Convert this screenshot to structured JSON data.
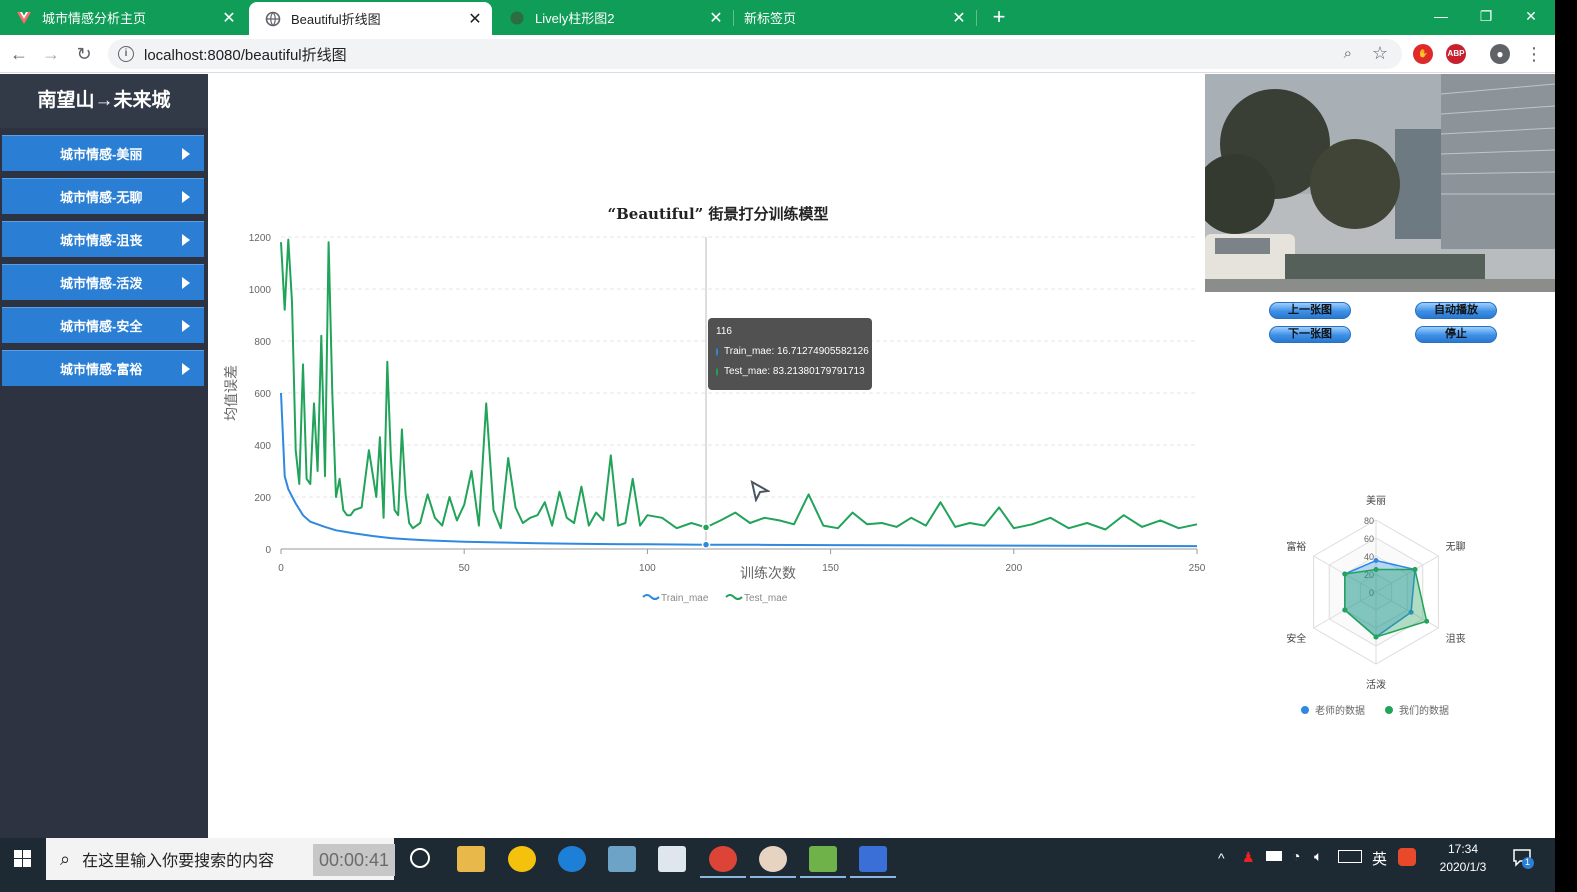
{
  "browser": {
    "tabs": [
      {
        "title": "城市情感分析主页",
        "active": false
      },
      {
        "title": "Beautiful折线图",
        "active": true
      },
      {
        "title": "Lively柱形图2",
        "active": false
      },
      {
        "title": "新标签页",
        "active": false
      }
    ],
    "url": "localhost:8080/beautiful折线图"
  },
  "sidebar": {
    "brand": "南望山→未来城",
    "items": [
      {
        "label": "城市情感-美丽"
      },
      {
        "label": "城市情感-无聊"
      },
      {
        "label": "城市情感-沮丧"
      },
      {
        "label": "城市情感-活泼"
      },
      {
        "label": "城市情感-安全"
      },
      {
        "label": "城市情感-富裕"
      }
    ]
  },
  "tooltip": {
    "title": "116",
    "rows": [
      {
        "name": "Train_mae",
        "value": "16.71274905582126",
        "color": "#2f89e0"
      },
      {
        "name": "Test_mae",
        "value": "83.21380179791713",
        "color": "#22a35a"
      }
    ]
  },
  "chart_data": [
    {
      "type": "line",
      "title": "“Beautiful” 街景打分训练模型",
      "xlabel": "训练次数",
      "ylabel": "均值误差",
      "xlim": [
        0,
        250
      ],
      "ylim": [
        0,
        1200
      ],
      "xticks": [
        0,
        50,
        100,
        150,
        200,
        250
      ],
      "yticks": [
        0,
        200,
        400,
        600,
        800,
        1000,
        1200
      ],
      "grid": true,
      "legend_position": "bottom",
      "highlight_x": 116,
      "series": [
        {
          "name": "Train_mae",
          "color": "#2f89e0",
          "x": [
            0,
            1,
            2,
            4,
            6,
            8,
            10,
            12,
            15,
            18,
            20,
            25,
            30,
            35,
            40,
            50,
            60,
            70,
            80,
            90,
            100,
            116,
            130,
            150,
            175,
            200,
            225,
            250
          ],
          "y": [
            600,
            280,
            230,
            175,
            130,
            105,
            95,
            85,
            72,
            65,
            60,
            50,
            42,
            37,
            33,
            28,
            25,
            22,
            20,
            19,
            18,
            16.7,
            16,
            15,
            14,
            13,
            12,
            11
          ]
        },
        {
          "name": "Test_mae",
          "color": "#22a35a",
          "x": [
            0,
            1,
            2,
            3,
            4,
            5,
            6,
            7,
            8,
            9,
            10,
            11,
            12,
            13,
            14,
            15,
            16,
            17,
            18,
            19,
            20,
            22,
            24,
            26,
            27,
            28,
            29,
            30,
            31,
            32,
            33,
            34,
            35,
            36,
            38,
            40,
            42,
            44,
            46,
            48,
            50,
            52,
            54,
            56,
            58,
            60,
            62,
            64,
            66,
            68,
            70,
            72,
            74,
            76,
            78,
            80,
            82,
            84,
            86,
            88,
            90,
            92,
            94,
            96,
            98,
            100,
            104,
            108,
            112,
            116,
            120,
            124,
            128,
            132,
            136,
            140,
            144,
            148,
            152,
            156,
            160,
            164,
            168,
            172,
            176,
            180,
            184,
            188,
            192,
            196,
            200,
            205,
            210,
            215,
            220,
            225,
            230,
            235,
            240,
            245,
            250
          ],
          "y": [
            1180,
            920,
            1190,
            950,
            380,
            250,
            710,
            270,
            250,
            560,
            300,
            820,
            280,
            1180,
            600,
            200,
            270,
            150,
            130,
            130,
            150,
            160,
            380,
            200,
            430,
            120,
            720,
            350,
            150,
            130,
            460,
            210,
            100,
            80,
            100,
            210,
            120,
            90,
            200,
            110,
            170,
            300,
            90,
            560,
            150,
            80,
            350,
            160,
            100,
            120,
            130,
            180,
            90,
            220,
            120,
            100,
            240,
            90,
            140,
            110,
            360,
            90,
            100,
            270,
            90,
            130,
            120,
            80,
            100,
            83,
            110,
            140,
            100,
            120,
            110,
            95,
            210,
            90,
            80,
            140,
            95,
            100,
            85,
            120,
            90,
            180,
            85,
            100,
            90,
            160,
            80,
            95,
            120,
            80,
            100,
            75,
            130,
            85,
            110,
            80,
            95
          ]
        }
      ]
    },
    {
      "type": "radar",
      "title": "",
      "axes": [
        "美丽",
        "无聊",
        "沮丧",
        "活泼",
        "安全",
        "富裕"
      ],
      "rings": [
        0,
        20,
        40,
        60,
        80
      ],
      "max": 80,
      "series": [
        {
          "name": "老师的数据",
          "color": "#2f89e0",
          "values": [
            35,
            50,
            45,
            50,
            40,
            40
          ]
        },
        {
          "name": "我们的数据",
          "color": "#22a35a",
          "values": [
            25,
            50,
            65,
            50,
            40,
            40
          ]
        }
      ]
    }
  ],
  "photo_buttons": {
    "prev": "上一张图",
    "next": "下一张图",
    "autoplay": "自动播放",
    "stop": "停止"
  },
  "taskbar": {
    "search_placeholder": "在这里输入你要搜索的内容",
    "recording": "00:00:41",
    "ime": "英",
    "time": "17:34",
    "date": "2020/1/3",
    "notifications": "1"
  }
}
